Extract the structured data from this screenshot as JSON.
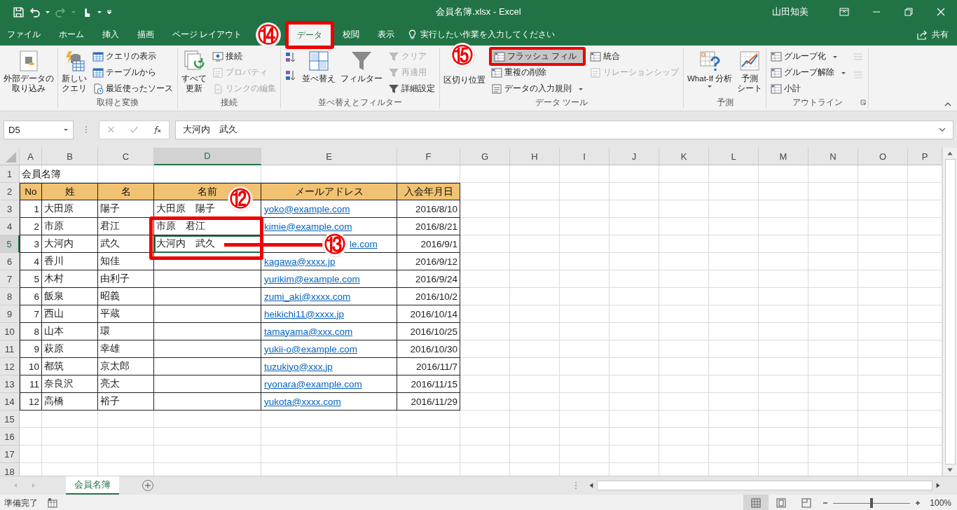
{
  "window": {
    "title": "会員名簿.xlsx  -  Excel",
    "user": "山田知美"
  },
  "ribbon_tabs": [
    {
      "label": "ファイル",
      "selected": false,
      "highlighted": false
    },
    {
      "label": "ホーム",
      "selected": false,
      "highlighted": false
    },
    {
      "label": "挿入",
      "selected": false,
      "highlighted": false
    },
    {
      "label": "描画",
      "selected": false,
      "highlighted": false
    },
    {
      "label": "ページ レイアウト",
      "selected": false,
      "highlighted": false
    },
    {
      "label": "データ",
      "selected": true,
      "highlighted": true
    },
    {
      "label": "校閲",
      "selected": false,
      "highlighted": false
    },
    {
      "label": "表示",
      "selected": false,
      "highlighted": false
    }
  ],
  "tell_me": "実行したい作業を入力してください",
  "share": "共有",
  "ribbon_groups": [
    {
      "items": [
        {
          "kind": "large",
          "lines": [
            "外部データの",
            "取り込み"
          ],
          "dropdown": true
        }
      ]
    },
    {
      "label": "取得と変換",
      "items": [
        {
          "kind": "large",
          "lines": [
            "新しい",
            "クエリ"
          ],
          "dropdown": true
        },
        {
          "kind": "stack",
          "items": [
            {
              "label": "クエリの表示",
              "disabled": false,
              "dropdown": false,
              "highlighted": false
            },
            {
              "label": "テーブルから",
              "disabled": false,
              "dropdown": false,
              "highlighted": false
            },
            {
              "label": "最近使ったソース",
              "disabled": false,
              "dropdown": false,
              "highlighted": false
            }
          ]
        }
      ]
    },
    {
      "label": "接続",
      "items": [
        {
          "kind": "large",
          "lines": [
            "すべて",
            "更新"
          ],
          "dropdown": true
        },
        {
          "kind": "stack",
          "items": [
            {
              "label": "接続",
              "disabled": false,
              "dropdown": false,
              "highlighted": false
            },
            {
              "label": "プロパティ",
              "disabled": true,
              "dropdown": false,
              "highlighted": false
            },
            {
              "label": "リンクの編集",
              "disabled": true,
              "dropdown": false,
              "highlighted": false
            }
          ]
        }
      ]
    },
    {
      "label": "並べ替えとフィルター",
      "items": [
        {
          "kind": "icons",
          "items": [
            {
              "disabled": false
            },
            {
              "disabled": false
            }
          ]
        },
        {
          "kind": "large",
          "lines": [
            "並べ替え"
          ],
          "dropdown": false
        },
        {
          "kind": "large",
          "lines": [
            "フィルター"
          ],
          "dropdown": false
        },
        {
          "kind": "stack",
          "items": [
            {
              "label": "クリア",
              "disabled": true,
              "dropdown": false,
              "highlighted": false
            },
            {
              "label": "再適用",
              "disabled": true,
              "dropdown": false,
              "highlighted": false
            },
            {
              "label": "詳細設定",
              "disabled": false,
              "dropdown": false,
              "highlighted": false
            }
          ]
        }
      ]
    },
    {
      "label": "データ ツール",
      "items": [
        {
          "kind": "large",
          "lines": [
            "区切り位置"
          ],
          "dropdown": false
        },
        {
          "kind": "stack",
          "items": [
            {
              "label": "フラッシュ フィル",
              "disabled": false,
              "dropdown": false,
              "highlighted": true
            },
            {
              "label": "重複の削除",
              "disabled": false,
              "dropdown": false,
              "highlighted": false
            },
            {
              "label": "データの入力規則",
              "disabled": false,
              "dropdown": true,
              "highlighted": false
            }
          ]
        },
        {
          "kind": "stack",
          "items": [
            {
              "label": "統合",
              "disabled": false,
              "dropdown": false,
              "highlighted": false
            },
            {
              "label": "リレーションシップ",
              "disabled": true,
              "dropdown": false,
              "highlighted": false
            }
          ]
        }
      ]
    },
    {
      "label": "予測",
      "items": [
        {
          "kind": "large",
          "lines": [
            "What-If 分析"
          ],
          "dropdown": true
        },
        {
          "kind": "large",
          "lines": [
            "予測",
            "シート"
          ],
          "dropdown": false
        }
      ]
    },
    {
      "label": "アウトライン",
      "launcher": true,
      "items": [
        {
          "kind": "stack",
          "items": [
            {
              "label": "グループ化",
              "disabled": false,
              "dropdown": true,
              "highlighted": false
            },
            {
              "label": "グループ解除",
              "disabled": false,
              "dropdown": true,
              "highlighted": false
            },
            {
              "label": "小計",
              "disabled": false,
              "dropdown": false,
              "highlighted": false
            }
          ]
        },
        {
          "kind": "icons",
          "items": [
            {
              "disabled": true
            },
            {
              "disabled": true
            }
          ]
        }
      ]
    }
  ],
  "formula_bar": {
    "name_box": "D5",
    "formula": "大河内　武久"
  },
  "callouts": [
    "⑭",
    "⑮",
    "⑫",
    "⑬"
  ],
  "sheet": {
    "columns": [
      {
        "label": "A",
        "selected": false
      },
      {
        "label": "B",
        "selected": false
      },
      {
        "label": "C",
        "selected": false
      },
      {
        "label": "D",
        "selected": true
      },
      {
        "label": "E",
        "selected": false
      },
      {
        "label": "F",
        "selected": false
      },
      {
        "label": "G",
        "selected": false
      },
      {
        "label": "H",
        "selected": false
      },
      {
        "label": "I",
        "selected": false
      },
      {
        "label": "J",
        "selected": false
      },
      {
        "label": "K",
        "selected": false
      },
      {
        "label": "L",
        "selected": false
      },
      {
        "label": "M",
        "selected": false
      },
      {
        "label": "N",
        "selected": false
      },
      {
        "label": "O",
        "selected": false
      },
      {
        "label": "P",
        "selected": false
      }
    ],
    "rows": [
      {
        "num": "1",
        "selected": false,
        "kind": "title",
        "text": "会員名簿"
      },
      {
        "num": "2",
        "selected": false,
        "kind": "header",
        "cells": [
          "No",
          "姓",
          "名",
          "名前",
          "メールアドレス",
          "入会年月日"
        ]
      },
      {
        "num": "3",
        "selected": false,
        "kind": "data",
        "no": "1",
        "last": "大田原",
        "first": "陽子",
        "name": "大田原　陽子",
        "email": "yoko@example.com",
        "joined": "2016/8/10"
      },
      {
        "num": "4",
        "selected": false,
        "kind": "data",
        "no": "2",
        "last": "市原",
        "first": "君江",
        "name": "市原　君江",
        "email": "kimie@example.com",
        "joined": "2016/8/21"
      },
      {
        "num": "5",
        "selected": true,
        "kind": "data",
        "no": "3",
        "last": "大河内",
        "first": "武久",
        "name": "大河内　武久",
        "email_tail": "le.com",
        "joined": "2016/9/1"
      },
      {
        "num": "6",
        "selected": false,
        "kind": "data",
        "no": "4",
        "last": "香川",
        "first": "知佳",
        "email": "kagawa@xxxx.jp",
        "joined": "2016/9/12"
      },
      {
        "num": "7",
        "selected": false,
        "kind": "data",
        "no": "5",
        "last": "木村",
        "first": "由利子",
        "email": "yurikim@example.com",
        "joined": "2016/9/24"
      },
      {
        "num": "8",
        "selected": false,
        "kind": "data",
        "no": "6",
        "last": "飯泉",
        "first": "昭義",
        "email": "zumi_aki@xxxx.com",
        "joined": "2016/10/2"
      },
      {
        "num": "9",
        "selected": false,
        "kind": "data",
        "no": "7",
        "last": "西山",
        "first": "平蔵",
        "email": "heikichi11@xxxx.jp",
        "joined": "2016/10/14"
      },
      {
        "num": "10",
        "selected": false,
        "kind": "data",
        "no": "8",
        "last": "山本",
        "first": "環",
        "email": "tamayama@xxx.com",
        "joined": "2016/10/25"
      },
      {
        "num": "11",
        "selected": false,
        "kind": "data",
        "no": "9",
        "last": "萩原",
        "first": "幸雄",
        "email": "yukii-o@example.com",
        "joined": "2016/10/30"
      },
      {
        "num": "12",
        "selected": false,
        "kind": "data",
        "no": "10",
        "last": "都筑",
        "first": "京太郎",
        "email": "tuzukiyo@xxx.jp",
        "joined": "2016/11/7"
      },
      {
        "num": "13",
        "selected": false,
        "kind": "data",
        "no": "11",
        "last": "奈良沢",
        "first": "亮太",
        "email": "ryonara@example.com",
        "joined": "2016/11/15"
      },
      {
        "num": "14",
        "selected": false,
        "kind": "data",
        "no": "12",
        "last": "高橋",
        "first": "裕子",
        "email": "yukota@xxxx.com",
        "joined": "2016/11/29"
      },
      {
        "num": "15",
        "selected": false,
        "kind": "empty"
      },
      {
        "num": "16",
        "selected": false,
        "kind": "empty"
      },
      {
        "num": "17",
        "selected": false,
        "kind": "empty"
      },
      {
        "num": "18",
        "selected": false,
        "kind": "empty"
      }
    ]
  },
  "sheet_tabs": [
    {
      "label": "会員名簿",
      "selected": true
    }
  ],
  "status_bar": {
    "text": "準備完了",
    "zoom": "100%",
    "zoom_slider": {
      "level": 0.5
    },
    "views": [
      {
        "selected": true
      },
      {
        "selected": false
      },
      {
        "selected": false
      }
    ]
  }
}
